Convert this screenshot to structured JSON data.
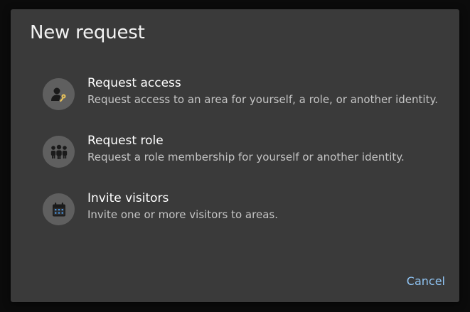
{
  "dialog": {
    "title": "New request",
    "options": [
      {
        "title": "Request access",
        "description": "Request access to an area for yourself, a role, or another identity.",
        "icon": "person-key-icon"
      },
      {
        "title": "Request role",
        "description": "Request a role membership for yourself or another identity.",
        "icon": "group-icon"
      },
      {
        "title": "Invite visitors",
        "description": "Invite one or more visitors to areas.",
        "icon": "calendar-icon"
      }
    ],
    "cancel_label": "Cancel"
  },
  "colors": {
    "backdrop": "#0b0b0b",
    "dialog_bg": "#3a3a3a",
    "icon_circle": "#5f5f5f",
    "key_accent": "#e8c25a",
    "link": "#8fc3f2"
  }
}
